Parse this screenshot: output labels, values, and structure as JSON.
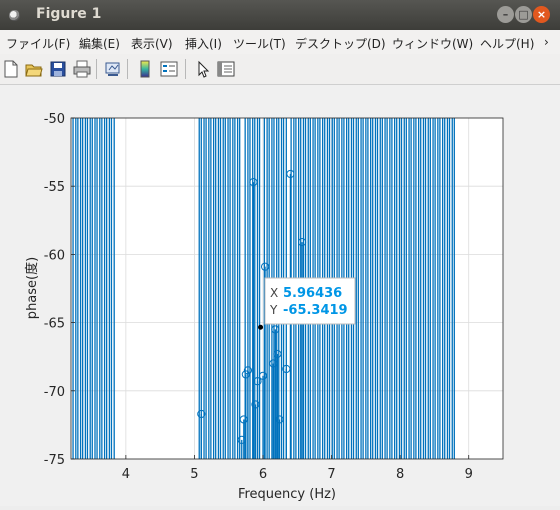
{
  "window": {
    "title": "Figure 1"
  },
  "menu": [
    "ファイル(F)",
    "編集(E)",
    "表示(V)",
    "挿入(I)",
    "ツール(T)",
    "デスクトップ(D)",
    "ウィンドウ(W)",
    "ヘルプ(H)"
  ],
  "toolbar": [
    "new-figure-icon",
    "open-file-icon",
    "save-icon",
    "print-icon",
    "link-plot-icon",
    "insert-colorbar-icon",
    "insert-legend-icon",
    "edit-plot-arrow-icon",
    "property-inspector-icon"
  ],
  "chart_data": {
    "type": "stem",
    "xlabel": "Frequency (Hz)",
    "ylabel": "phase(度)",
    "xlim": [
      3.2,
      9.5
    ],
    "ylim": [
      -75,
      -50
    ],
    "xticks": [
      4,
      5,
      6,
      7,
      8,
      9
    ],
    "yticks": [
      -50,
      -55,
      -60,
      -65,
      -70,
      -75
    ],
    "grid": true,
    "color": "#0072bd",
    "baseline": 0,
    "offscale_stems_x": [
      3.23,
      3.27,
      3.3,
      3.34,
      3.37,
      3.41,
      3.44,
      3.48,
      3.51,
      3.55,
      3.58,
      3.62,
      3.65,
      3.69,
      3.72,
      3.76,
      3.79,
      3.83,
      5.07,
      5.1,
      5.14,
      5.17,
      5.21,
      5.24,
      5.28,
      5.31,
      5.35,
      5.38,
      5.42,
      5.45,
      5.49,
      5.52,
      5.56,
      5.59,
      5.63,
      5.66,
      5.74,
      5.78,
      5.81,
      5.85,
      5.88,
      5.92,
      5.95,
      6.02,
      6.06,
      6.09,
      6.13,
      6.16,
      6.2,
      6.23,
      6.27,
      6.3,
      6.34,
      6.41,
      6.45,
      6.48,
      6.52,
      6.55,
      6.59,
      6.62,
      6.66,
      6.69,
      6.73,
      6.76,
      6.8,
      6.83,
      6.87,
      6.9,
      6.94,
      6.97,
      7.01,
      7.04,
      7.08,
      7.11,
      7.15,
      7.18,
      7.22,
      7.25,
      7.29,
      7.32,
      7.36,
      7.39,
      7.43,
      7.46,
      7.5,
      7.53,
      7.57,
      7.6,
      7.64,
      7.67,
      7.71,
      7.74,
      7.78,
      7.81,
      7.85,
      7.88,
      7.92,
      7.95,
      7.99,
      8.02,
      8.06,
      8.09,
      8.13,
      8.16,
      8.2,
      8.23,
      8.27,
      8.3,
      8.34,
      8.37,
      8.41,
      8.44,
      8.48,
      8.51,
      8.55,
      8.58,
      8.62,
      8.65,
      8.69,
      8.72,
      8.76,
      8.79
    ],
    "points": [
      {
        "x": 5.1,
        "y": -71.7
      },
      {
        "x": 5.69,
        "y": -73.6
      },
      {
        "x": 5.72,
        "y": -72.1
      },
      {
        "x": 5.75,
        "y": -68.8
      },
      {
        "x": 5.78,
        "y": -68.5
      },
      {
        "x": 5.86,
        "y": -54.7
      },
      {
        "x": 5.89,
        "y": -71.0
      },
      {
        "x": 5.92,
        "y": -69.3
      },
      {
        "x": 6.0,
        "y": -68.9
      },
      {
        "x": 6.03,
        "y": -60.9
      },
      {
        "x": 6.15,
        "y": -68.0
      },
      {
        "x": 6.18,
        "y": -65.5
      },
      {
        "x": 6.21,
        "y": -67.3
      },
      {
        "x": 6.24,
        "y": -72.1
      },
      {
        "x": 6.34,
        "y": -68.4
      },
      {
        "x": 6.4,
        "y": -54.1
      },
      {
        "x": 6.57,
        "y": -59.1
      }
    ],
    "datatip": {
      "x_label": "X",
      "x_value": "5.96436",
      "y_label": "Y",
      "y_value": "-65.3419",
      "x": 5.96436,
      "y": -65.3419
    }
  }
}
